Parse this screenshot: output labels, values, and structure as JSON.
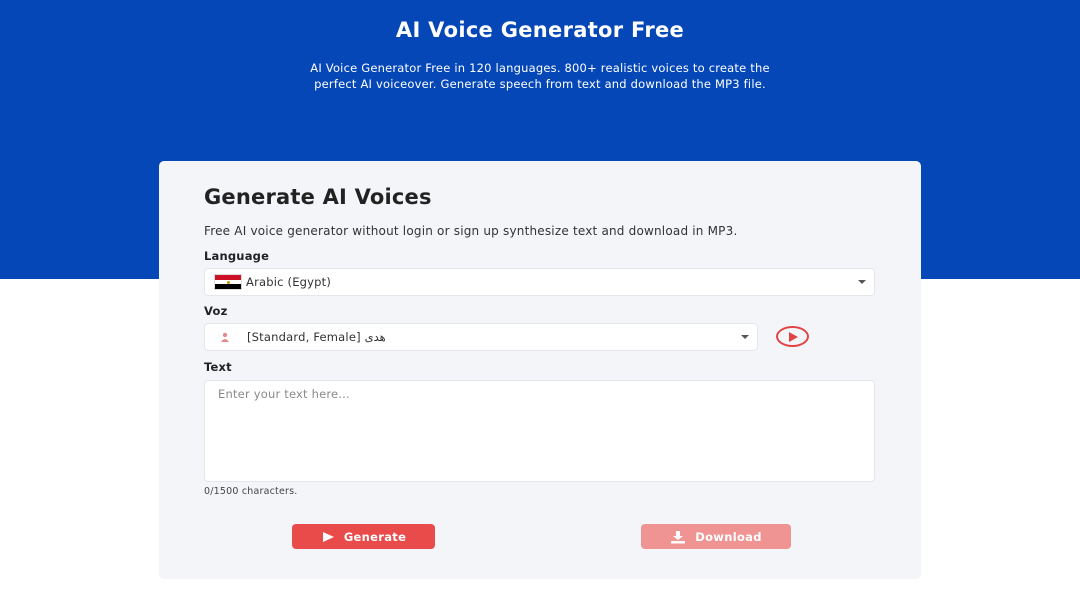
{
  "hero": {
    "title": "AI Voice Generator Free",
    "subtitle_line1": "AI Voice Generator Free in 120 languages. 800+ realistic voices to create the",
    "subtitle_line2": "perfect AI voiceover. Generate speech from text and download the MP3 file."
  },
  "card": {
    "title": "Generate AI Voices",
    "description": "Free AI voice generator without login or sign up synthesize text and download in MP3."
  },
  "language": {
    "label": "Language",
    "selected": "Arabic (Egypt)",
    "flag_icon": "egypt-flag-icon",
    "flag_colors": [
      "#ce1126",
      "#ffffff",
      "#000000"
    ]
  },
  "voice": {
    "label": "Voz",
    "selected": "[Standard, Female] هدى",
    "icon": "female-voice-icon",
    "play_icon": "play-circle-icon"
  },
  "text": {
    "label": "Text",
    "placeholder": "Enter your text here...",
    "value": "",
    "counter": "0/1500 characters."
  },
  "actions": {
    "generate_label": "Generate",
    "generate_icon": "play-icon",
    "download_label": "Download",
    "download_icon": "download-icon"
  },
  "colors": {
    "hero_bg": "#0547b7",
    "accent": "#e94a4a",
    "accent_disabled": "#ef9393",
    "card_bg": "#f4f5f9"
  }
}
